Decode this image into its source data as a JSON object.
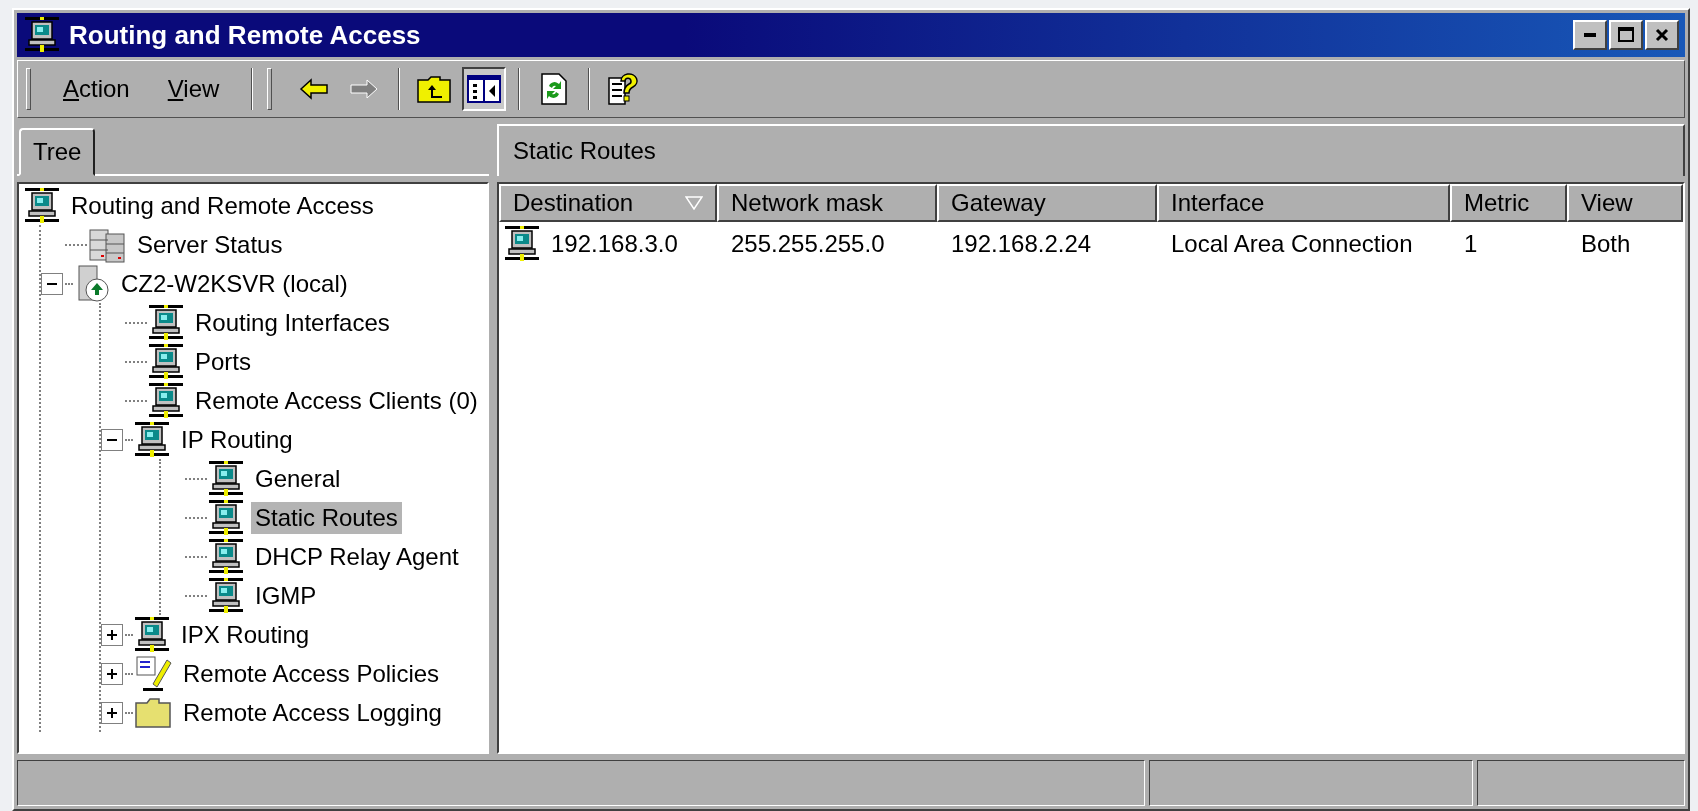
{
  "window": {
    "title": "Routing and Remote Access"
  },
  "menu": [
    {
      "label": "Action"
    },
    {
      "label": "View"
    }
  ],
  "toolbar": [
    {
      "kind": "back",
      "disabled": false
    },
    {
      "kind": "forward",
      "disabled": true
    },
    {
      "kind": "sep"
    },
    {
      "kind": "up",
      "pressed": false
    },
    {
      "kind": "tree",
      "pressed": true
    },
    {
      "kind": "sep"
    },
    {
      "kind": "refresh",
      "pressed": false
    },
    {
      "kind": "sep"
    },
    {
      "kind": "help",
      "pressed": false
    }
  ],
  "left_tabs": [
    {
      "label": "Tree",
      "selected": true
    }
  ],
  "tree": [
    {
      "label": "Routing and Remote Access",
      "kind": "network",
      "selected": false,
      "children": [
        {
          "label": "Server Status",
          "kind": "servers",
          "selected": false
        },
        {
          "label": "CZ2-W2KSVR (local)",
          "kind": "server",
          "selected": false,
          "expanded": true,
          "children": [
            {
              "label": "Routing Interfaces",
              "kind": "network",
              "selected": false
            },
            {
              "label": "Ports",
              "kind": "network",
              "selected": false
            },
            {
              "label": "Remote Access Clients (0)",
              "kind": "network",
              "selected": false
            },
            {
              "label": "IP Routing",
              "kind": "network",
              "selected": false,
              "expanded": true,
              "children": [
                {
                  "label": "General",
                  "kind": "network",
                  "selected": false
                },
                {
                  "label": "Static Routes",
                  "kind": "network",
                  "selected": true
                },
                {
                  "label": "DHCP Relay Agent",
                  "kind": "network",
                  "selected": false
                },
                {
                  "label": "IGMP",
                  "kind": "network",
                  "selected": false
                }
              ]
            },
            {
              "label": "IPX Routing",
              "kind": "network",
              "selected": false,
              "expanded": false
            },
            {
              "label": "Remote Access Policies",
              "kind": "policy",
              "selected": false,
              "expanded": false
            },
            {
              "label": "Remote Access Logging",
              "kind": "folder",
              "selected": false,
              "expanded": false
            }
          ]
        }
      ]
    }
  ],
  "pane": {
    "title": "Static Routes",
    "columns": [
      {
        "label": "Destination",
        "sorted": true
      },
      {
        "label": "Network mask",
        "sorted": false
      },
      {
        "label": "Gateway",
        "sorted": false
      },
      {
        "label": "Interface",
        "sorted": false
      },
      {
        "label": "Metric",
        "sorted": false
      },
      {
        "label": "View",
        "sorted": false
      }
    ],
    "rows": [
      {
        "cells": [
          "192.168.3.0",
          "255.255.255.0",
          "192.168.2.24",
          "Local Area Connection",
          "1",
          "Both"
        ]
      }
    ]
  }
}
